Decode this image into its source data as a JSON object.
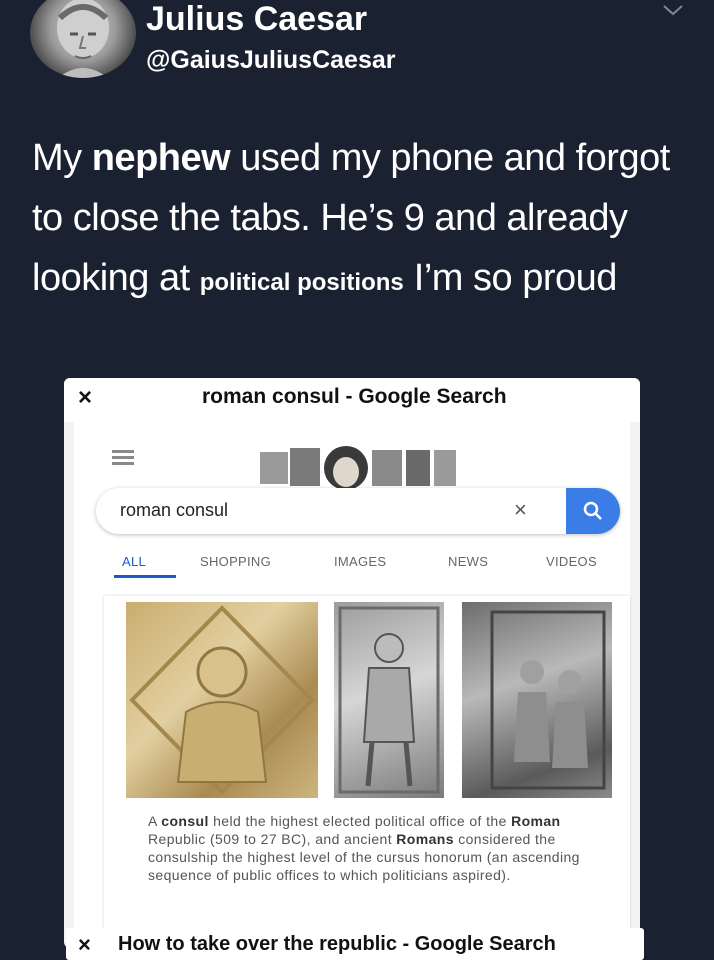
{
  "tweet": {
    "display_name": "Julius Caesar",
    "handle": "@GaiusJuliusCaesar",
    "text_part1": "My ",
    "text_bold": "nephew",
    "text_part2": "  used my phone and forgot to close the tabs. He’s 9 and already looking at ",
    "text_small_bold": "political positions",
    "text_part3": " I’m so proud"
  },
  "tab1": {
    "close_glyph": "×",
    "title": "roman consul - Google Search",
    "search_value": "roman consul",
    "clear_glyph": "×",
    "tabs": [
      "ALL",
      "SHOPPING",
      "IMAGES",
      "NEWS",
      "VIDEOS"
    ],
    "snippet": {
      "s1": "A ",
      "b1": "consul",
      "s2": " held the highest elected political office of the ",
      "b2": "Roman",
      "s3": " Republic (509 to 27 BC), and ancient ",
      "b3": "Romans",
      "s4": " considered the consulship the highest level of the cursus honorum (an ascending sequence of public offices to which politicians aspired)."
    }
  },
  "tab2": {
    "close_glyph": "×",
    "title": "How to take over the republic - Google Search"
  },
  "colors": {
    "background": "#1a2130",
    "accent_blue": "#3b7de6",
    "active_tab": "#1a59c9"
  },
  "icons": [
    "avatar-bust",
    "chevron-down-icon",
    "close-icon",
    "hamburger-icon",
    "search-icon"
  ]
}
